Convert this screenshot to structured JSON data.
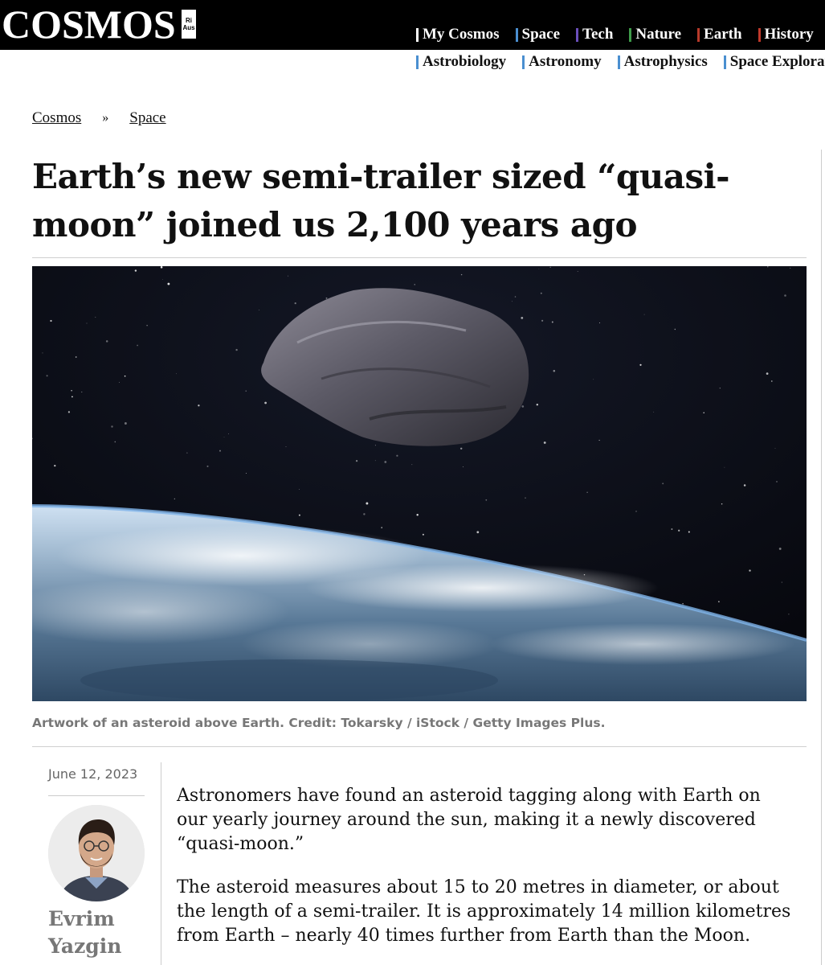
{
  "site": {
    "logo": "COSMOS",
    "badge_top": "Ri",
    "badge_bottom": "Aus"
  },
  "nav": {
    "primary": [
      {
        "label": "My Cosmos",
        "color": "#ffffff"
      },
      {
        "label": "Space",
        "color": "#4a8fd0"
      },
      {
        "label": "Tech",
        "color": "#6b4fbb"
      },
      {
        "label": "Nature",
        "color": "#3f9c4a"
      },
      {
        "label": "Earth",
        "color": "#b83a2a"
      },
      {
        "label": "History",
        "color": "#c0392b"
      }
    ],
    "secondary": [
      {
        "label": "Astrobiology"
      },
      {
        "label": "Astronomy"
      },
      {
        "label": "Astrophysics"
      },
      {
        "label": "Space Exploration"
      }
    ]
  },
  "breadcrumb": {
    "home": "Cosmos",
    "separator": "»",
    "section": "Space"
  },
  "article": {
    "title": "Earth’s new semi-trailer sized “quasi-moon” joined us 2,100 years ago",
    "caption": "Artwork of an asteroid above Earth. Credit: Tokarsky / iStock / Getty Images Plus.",
    "date": "June 12, 2023",
    "author": "Evrim Yazgin",
    "paragraphs": [
      "Astronomers have found an asteroid tagging along with Earth on our yearly journey around the sun, making it a newly discovered “quasi-moon.”",
      "The asteroid measures about 15 to 20 metres in diameter, or about the length of a semi-trailer. It is approximately 14 million kilometres from Earth – nearly 40 times further from Earth than the Moon."
    ]
  }
}
